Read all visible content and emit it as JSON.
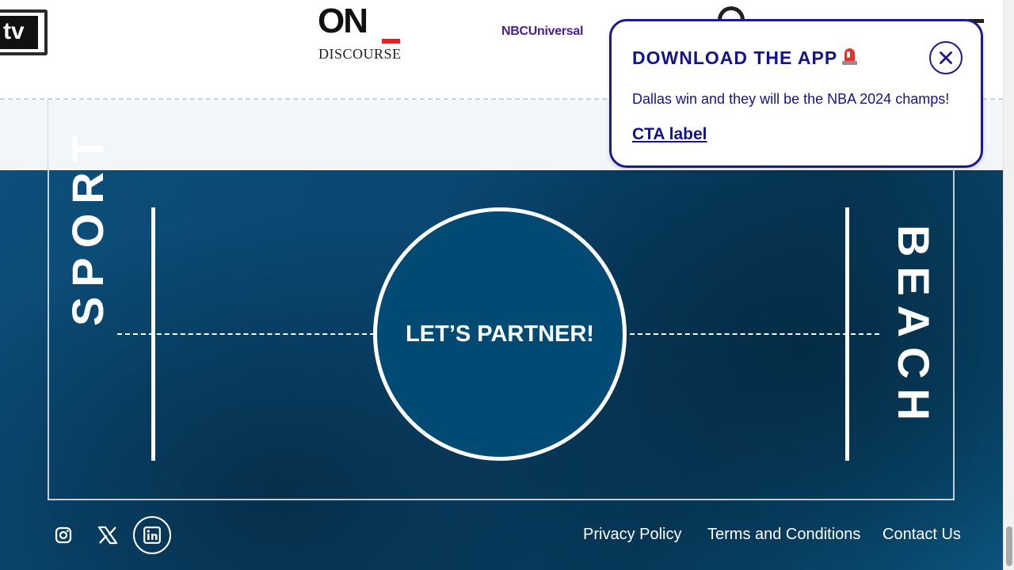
{
  "logos": {
    "tv_label": "tv",
    "on_discourse_main": "ON",
    "on_discourse_sub": "DISCOURSE",
    "nbcuniversal": "NBCUniversal"
  },
  "court": {
    "left_word": "SPORT",
    "right_word": "BEACH",
    "partner_label": "LET’S PARTNER!"
  },
  "footer": {
    "social": [
      {
        "name": "instagram-icon"
      },
      {
        "name": "x-icon"
      },
      {
        "name": "linkedin-icon"
      }
    ],
    "links": [
      "Privacy Policy",
      "Terms and Conditions",
      "Contact Us"
    ]
  },
  "popup": {
    "title": "DOWNLOAD THE APP",
    "title_icon": "siren-icon",
    "message": "Dallas win and they will be the NBA 2024 champs!",
    "cta_label": "CTA label",
    "close_icon": "close-icon"
  },
  "colors": {
    "popup_accent": "#1a1a8c",
    "court_blue": "#0a4670",
    "circle_fill": "#004a74"
  }
}
